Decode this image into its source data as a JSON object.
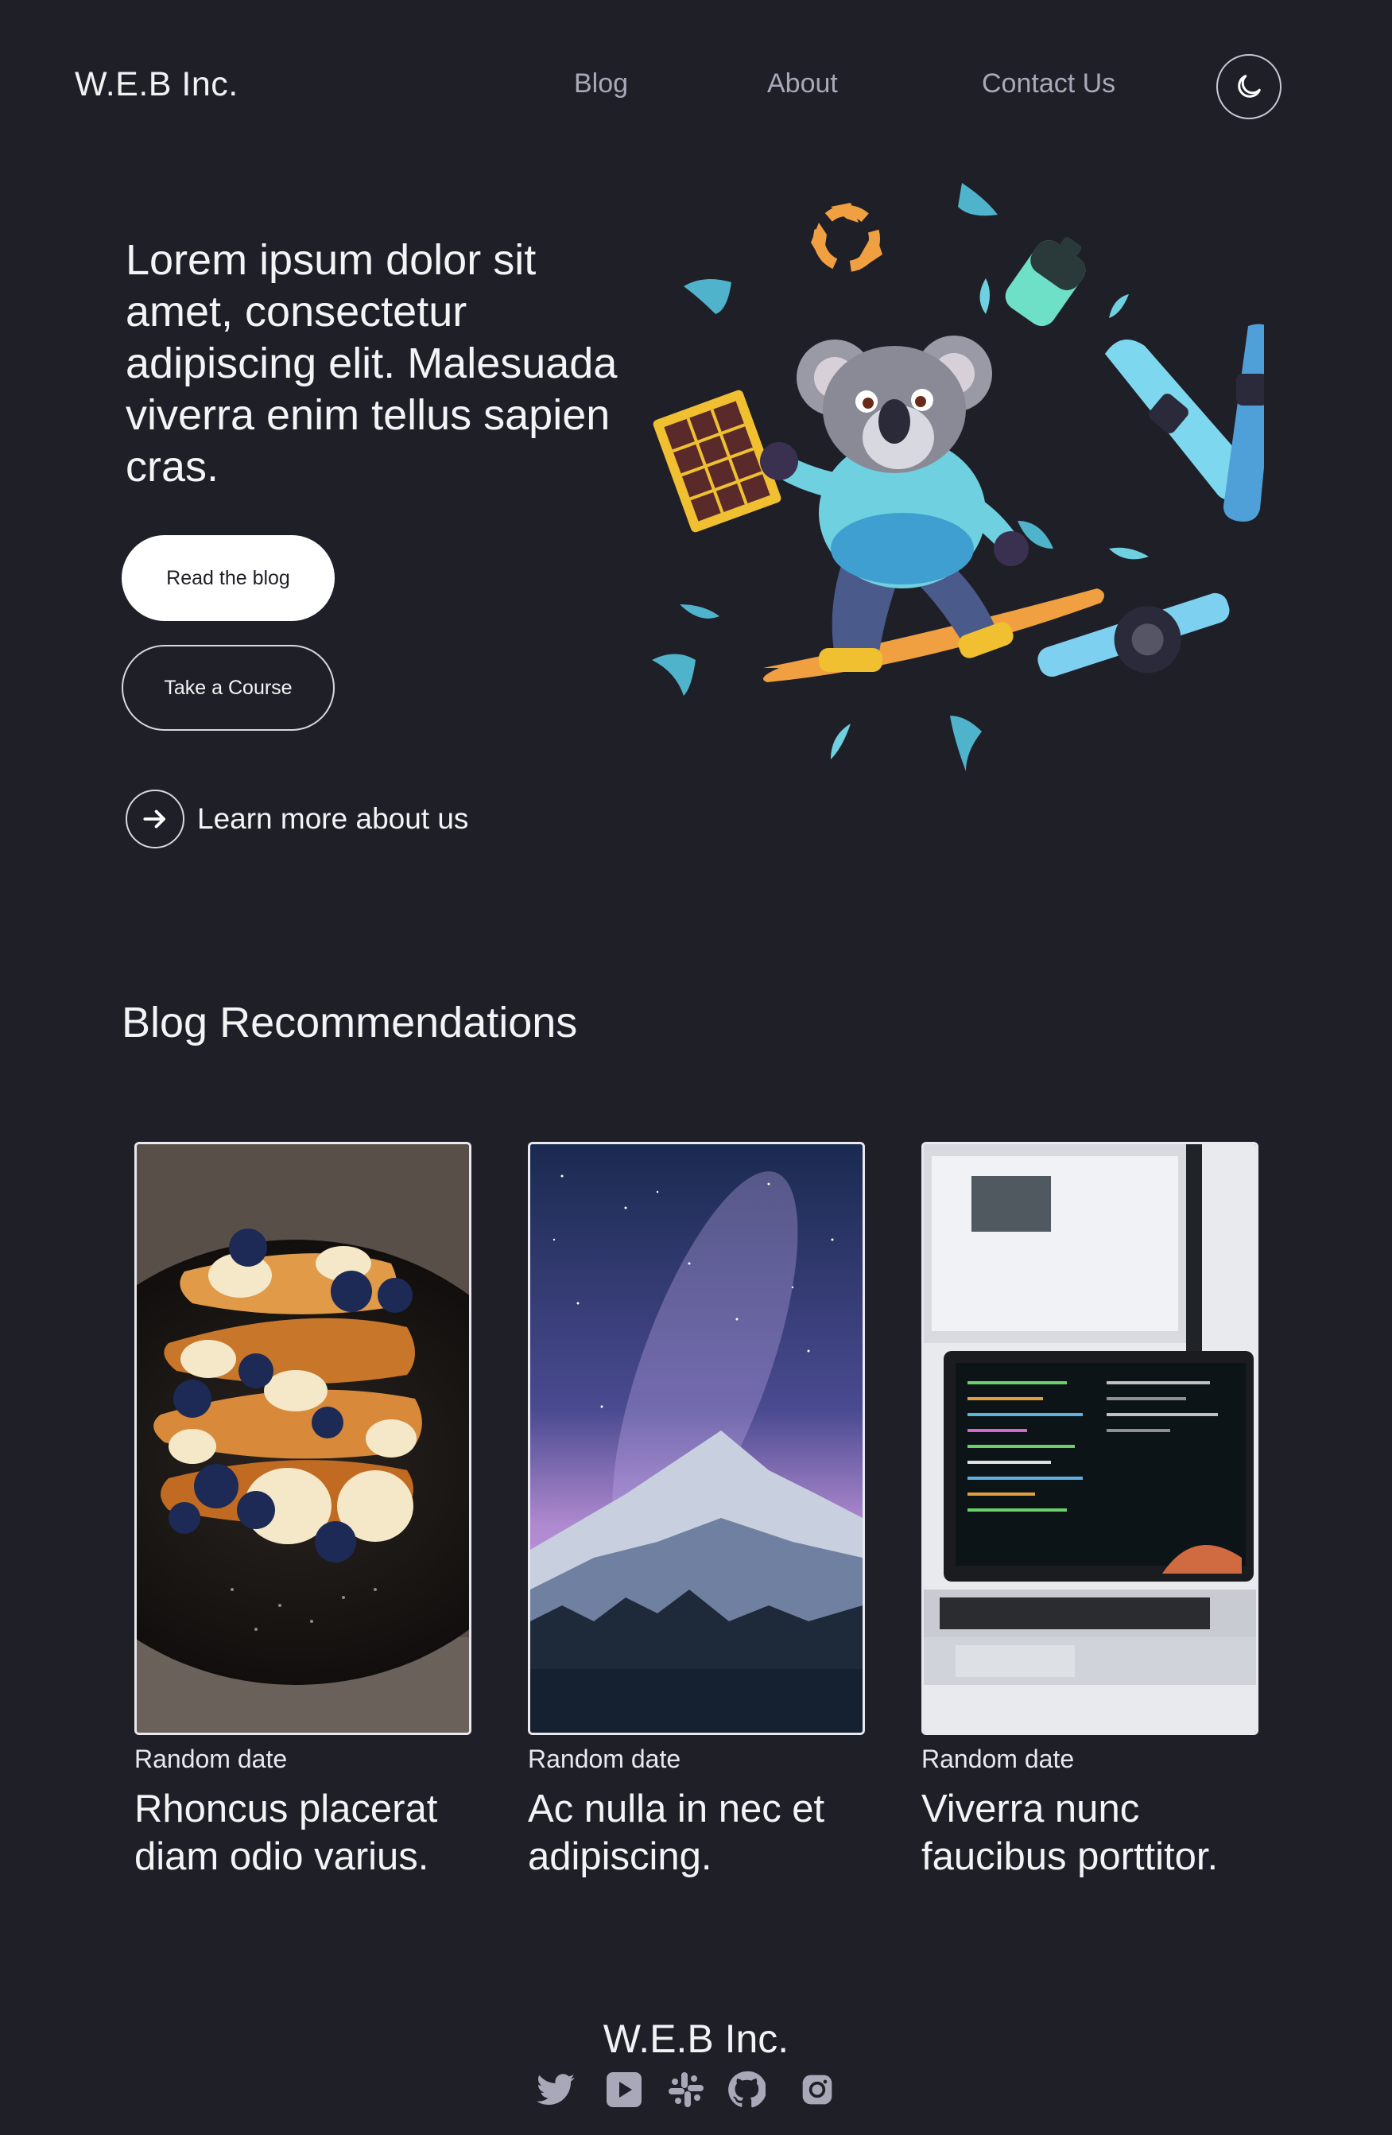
{
  "header": {
    "logo": "W.E.B Inc.",
    "nav": [
      {
        "label": "Blog"
      },
      {
        "label": "About"
      },
      {
        "label": "Contact Us"
      }
    ],
    "theme_toggle_icon": "moon-icon"
  },
  "hero": {
    "title": "Lorem ipsum dolor sit amet, consectetur adipiscing elit. Malesuada viverra enim tellus sapien cras.",
    "primary_button": "Read the blog",
    "secondary_button": "Take a Course",
    "learn_more": "Learn more about us",
    "learn_more_icon": "arrow-right-icon"
  },
  "blog": {
    "section_title": "Blog Recommendations",
    "cards": [
      {
        "date": "Random date",
        "title": "Rhoncus placerat diam odio varius."
      },
      {
        "date": "Random date",
        "title": "Ac nulla in nec et adipiscing."
      },
      {
        "date": "Random date",
        "title": "Viverra nunc faucibus porttitor."
      }
    ]
  },
  "footer": {
    "logo": "W.E.B Inc.",
    "social_icons": [
      "twitter-icon",
      "youtube-icon",
      "slack-icon",
      "github-icon",
      "instagram-icon"
    ]
  },
  "colors": {
    "background": "#1f1f28",
    "text": "#ffffff",
    "muted": "#a8a8b8",
    "accent_teal": "#6fd0e0",
    "accent_orange": "#f0a040"
  }
}
